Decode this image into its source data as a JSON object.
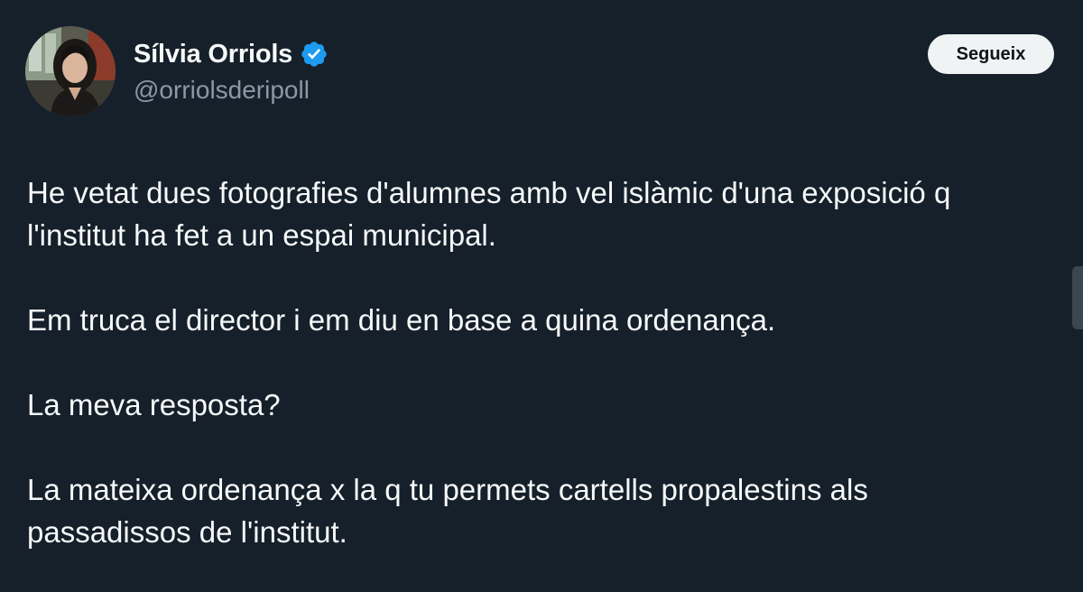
{
  "author": {
    "display_name": "Sílvia Orriols",
    "handle": "@orriolsderipoll",
    "verified": true,
    "avatar_icon": "profile-photo"
  },
  "actions": {
    "follow_label": "Segueix"
  },
  "tweet": {
    "paragraphs": [
      "He vetat dues fotografies d'alumnes amb vel islàmic d'una exposició q",
      "l'institut ha fet a un espai municipal.",
      "Em truca el director i em diu en base a quina ordenança.",
      "La meva resposta?",
      "La mateixa ordenança x la q tu permets cartells propalestins als",
      "passadissos de l'institut."
    ]
  },
  "colors": {
    "background": "#15202b",
    "text": "#f7f9f9",
    "secondary_text": "#8b98a5",
    "verified_blue": "#1d9bf0",
    "button_bg": "#eff3f4"
  }
}
